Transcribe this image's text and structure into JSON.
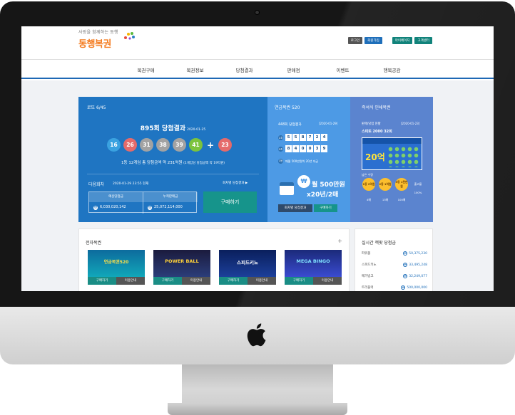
{
  "header": {
    "tagline": "사랑을 함께하는 동행",
    "logo": "동행복권",
    "buttons": [
      "로그인",
      "회원가입",
      "마이페이지",
      "고객센터"
    ]
  },
  "nav": [
    "복권구매",
    "복권정보",
    "당첨결과",
    "판매점",
    "이벤트",
    "행복공감"
  ],
  "lotto": {
    "title": "로또 6/45",
    "draw": "895회 당첨결과",
    "draw_date": "2020-01-25",
    "numbers": [
      "16",
      "26",
      "31",
      "38",
      "39",
      "41"
    ],
    "bonus": "23",
    "info_main": "1등 12게임 총 당첨금액 약 231억원",
    "info_sub": "(1게임당 당첨금액 약 19억원)",
    "next_label": "다음회차",
    "next_date": "2020-01-29 23:55 현재",
    "prev_link": "회차별 당첨결과 ▶",
    "sales_head_1": "예상당첨금",
    "sales_head_2": "누적판매금",
    "sales_val_1": "6,030,020,142",
    "sales_val_2": "25,072,114,000",
    "buy": "구매하기"
  },
  "pension": {
    "title": "연금복권 520",
    "draw": "448회 당첨결과",
    "date": "[2020-01-29]",
    "row1_label": "1조",
    "row1": [
      "5",
      "5",
      "8",
      "7",
      "2",
      "4"
    ],
    "row2_label": "5조",
    "row2": [
      "8",
      "4",
      "0",
      "0",
      "3",
      "9"
    ],
    "note_label": "1등",
    "note": "매월 500만원씩 20년 지급",
    "coin": "₩",
    "amount_1": "월 500만원",
    "amount_2": "x20년/2매",
    "btn_results": "회차별 당첨결과",
    "btn_buy": "구매하기"
  },
  "instant": {
    "title": "즉석식 인쇄복권",
    "sub": "판매/당첨 현황",
    "date": "[2020-01-23]",
    "game": "스피또 2000 32회",
    "ticket_big": "20억",
    "remain_label": "남은 수량",
    "ranks": [
      {
        "label": "1등 2억원",
        "count": "4매"
      },
      {
        "label": "2등 1억원",
        "count": "13매"
      },
      {
        "label": "3등 1천만원",
        "count": "100매"
      }
    ],
    "last_top": "출고율",
    "last_val": "100%"
  },
  "electronic": {
    "title": "전자복권",
    "plus": "+",
    "cards": [
      {
        "name": "연금복권520",
        "buy": "구매하기",
        "guide": "이용안내"
      },
      {
        "name": "POWER BALL",
        "buy": "구매하기",
        "guide": "이용안내"
      },
      {
        "name": "스피드키노",
        "buy": "구매하기",
        "guide": "이용안내"
      },
      {
        "name": "MEGA BINGO",
        "buy": "구매하기",
        "guide": "이용안내"
      }
    ]
  },
  "realtime": {
    "title": "실시간 잭팟 당첨금",
    "rows": [
      {
        "name": "파워볼",
        "amount": "50,375,230"
      },
      {
        "name": "스피드키노",
        "amount": "33,495,248"
      },
      {
        "name": "메가빙고",
        "amount": "32,249,077"
      },
      {
        "name": "트리플럭",
        "amount": "500,000,000"
      }
    ]
  },
  "colors": {
    "lotto_bg": "#1f75c2",
    "pension_bg": "#4d9ae5",
    "instant_bg": "#5b84cf",
    "accent_teal": "#16948b",
    "ball_colors": [
      "#3aa2e0",
      "#e56a6a",
      "#a2a2a2",
      "#a2a2a2",
      "#a2a2a2",
      "#7cc33c",
      "#e56a6a"
    ]
  }
}
